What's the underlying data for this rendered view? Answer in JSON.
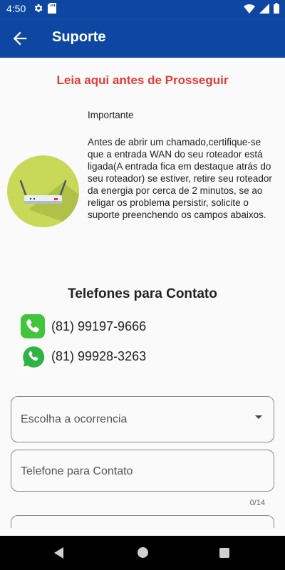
{
  "status_bar": {
    "time": "4:50",
    "left_icons": [
      "gear-icon",
      "sd-card-icon"
    ],
    "right_icons": [
      "wifi-icon",
      "signal-icon",
      "battery-icon"
    ]
  },
  "app_bar": {
    "title": "Suporte",
    "back_icon": "arrow-back-icon",
    "color": "#0d47a1"
  },
  "warning": {
    "title": "Leia aqui antes de Prosseguir",
    "color": "#e53935"
  },
  "info": {
    "image_icon": "router-icon",
    "heading": "Importante",
    "body": "Antes de abrir um chamado,certifique-se que a entrada WAN do seu roteador está ligada(A entrada fica em destaque atrás do seu roteador) se estiver, retire seu roteador da energia por cerca de 2 minutos, se ao religar os problema persistir, solicite o suporte preenchendo os campos abaixos."
  },
  "contacts": {
    "title": "Telefones para Contato",
    "phones": [
      {
        "icon": "phone-icon",
        "number": "(81) 99197-9666"
      },
      {
        "icon": "whatsapp-icon",
        "number": "(81) 99928-3263"
      }
    ]
  },
  "form": {
    "occurrence_select": {
      "placeholder": "Escolha a ocorrencia"
    },
    "phone_field": {
      "placeholder": "Telefone para Contato",
      "counter": "0/14"
    }
  },
  "nav_bar": {
    "icons": [
      "nav-back-icon",
      "nav-home-icon",
      "nav-recents-icon"
    ]
  }
}
